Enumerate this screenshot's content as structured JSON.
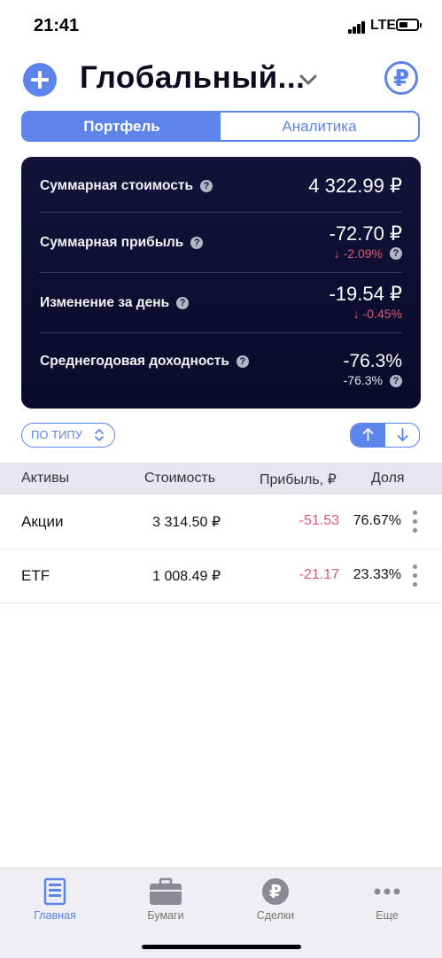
{
  "status": {
    "time": "21:41",
    "network": "LTE"
  },
  "header": {
    "title": "Глобальный...",
    "currency_symbol": "₽"
  },
  "segments": [
    {
      "label": "Портфель",
      "active": true
    },
    {
      "label": "Аналитика",
      "active": false
    }
  ],
  "summary": {
    "total_value": {
      "label": "Суммарная стоимость",
      "value": "4 322.99 ₽"
    },
    "total_profit": {
      "label": "Суммарная прибыль",
      "value": "-72.70 ₽",
      "percent": "-2.09%"
    },
    "day_change": {
      "label": "Изменение за день",
      "value": "-19.54 ₽",
      "percent": "-0.45%"
    },
    "annual_yield": {
      "label": "Среднегодовая доходность",
      "value": "-76.3%",
      "sub": "-76.3%"
    }
  },
  "controls": {
    "filter_label": "ПО ТИПУ"
  },
  "table": {
    "headers": {
      "asset": "Активы",
      "cost": "Стоимость",
      "profit": "Прибыль, ₽",
      "share": "Доля"
    },
    "rows": [
      {
        "name": "Акции",
        "cost": "3 314.50 ₽",
        "profit": "-51.53",
        "share": "76.67%"
      },
      {
        "name": "ETF",
        "cost": "1 008.49 ₽",
        "profit": "-21.17",
        "share": "23.33%"
      }
    ]
  },
  "tabbar": [
    {
      "label": "Главная",
      "icon": "home-doc-icon",
      "active": true
    },
    {
      "label": "Бумаги",
      "icon": "briefcase-icon",
      "active": false
    },
    {
      "label": "Сделки",
      "icon": "ruble-coin-icon",
      "active": false
    },
    {
      "label": "Еще",
      "icon": "more-dots-icon",
      "active": false
    }
  ],
  "colors": {
    "accent": "#5c84ea",
    "negative": "#e05a72",
    "card_bg": "#13123a"
  }
}
